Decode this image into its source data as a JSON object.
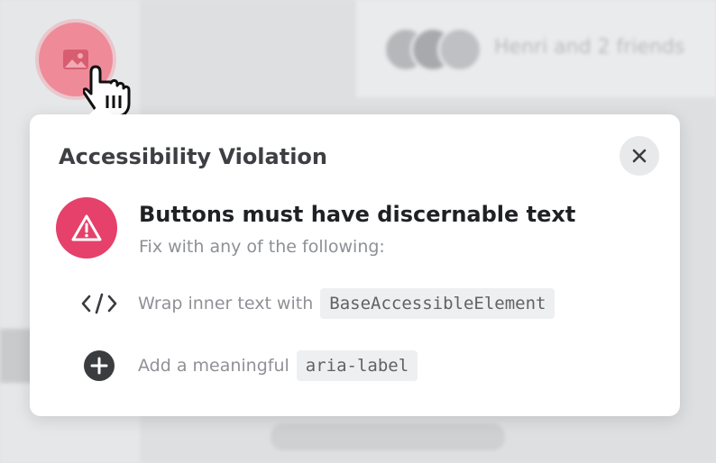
{
  "background": {
    "friends_label": "Henri and 2 friends"
  },
  "popover": {
    "title": "Accessibility Violation",
    "violation": {
      "heading": "Buttons must have discernable text",
      "subheading": "Fix with any of the following:"
    },
    "fixes": [
      {
        "icon": "code-icon",
        "text": "Wrap inner text with",
        "code": "BaseAccessibleElement"
      },
      {
        "icon": "plus-circle-icon",
        "text": "Add a meaningful",
        "code": "aria-label"
      }
    ]
  },
  "colors": {
    "warning": "#e5416a",
    "button_pink": "#ef8b99"
  }
}
